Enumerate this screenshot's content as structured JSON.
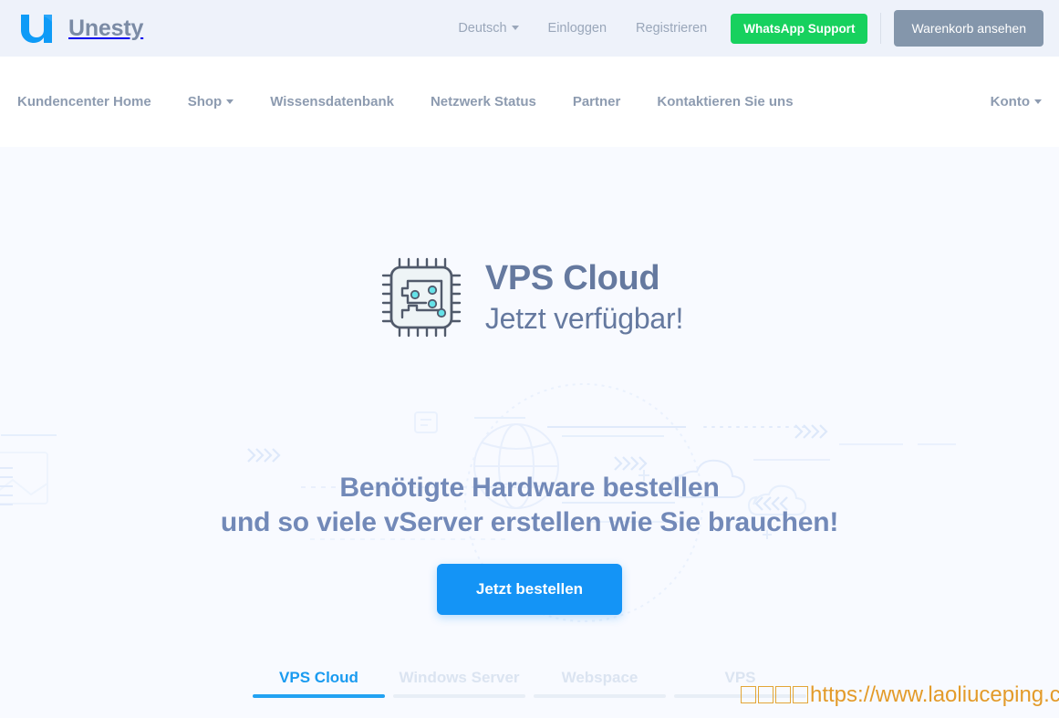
{
  "brand": {
    "name": "Unesty",
    "logo_icon": "unesty-logo-icon",
    "logo_color": "#0e9bf7"
  },
  "topbar": {
    "background": "#eef2fa",
    "language": {
      "label": "Deutsch",
      "icon": "chevron-down-icon"
    },
    "login_label": "Einloggen",
    "register_label": "Registrieren",
    "whatsapp_label": "WhatsApp Support",
    "whatsapp_color": "#17d15e",
    "cart_label": "Warenkorb ansehen",
    "cart_color": "#8496ab"
  },
  "mainnav": {
    "items": [
      {
        "label": "Kundencenter Home",
        "has_caret": false
      },
      {
        "label": "Shop",
        "has_caret": true
      },
      {
        "label": "Wissensdatenbank",
        "has_caret": false
      },
      {
        "label": "Netzwerk Status",
        "has_caret": false
      },
      {
        "label": "Partner",
        "has_caret": false
      },
      {
        "label": "Kontaktieren Sie uns",
        "has_caret": false
      }
    ],
    "account": {
      "label": "Konto",
      "icon": "chevron-down-icon"
    }
  },
  "hero": {
    "background": "#f8faff",
    "chip_icon": "cpu-chip-icon",
    "title": "VPS Cloud",
    "subtitle": "Jetzt verfügbar!",
    "title_color": "#65799f",
    "headline_line1": "Benötigte Hardware bestellen",
    "headline_line2": "und so viele vServer erstellen wie Sie brauchen!",
    "headline_color": "#7289b8",
    "cta_label": "Jetzt bestellen",
    "cta_color": "#1494f6"
  },
  "tabs": {
    "active_index": 0,
    "items": [
      {
        "label": "VPS Cloud"
      },
      {
        "label": "Windows Server"
      },
      {
        "label": "Webspace"
      },
      {
        "label": "VPS"
      }
    ],
    "active_color": "#22a2f2",
    "inactive_color": "#dbe4f1"
  },
  "watermark": {
    "boxes": 4,
    "url": "https://www.laoliuceping.com",
    "color": "#e39b2a"
  }
}
